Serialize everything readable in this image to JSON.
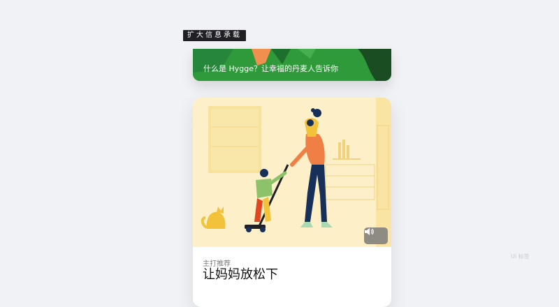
{
  "tag": {
    "label": "扩大信息承载"
  },
  "banner": {
    "title": "什么是 Hygge？让幸福的丹麦人告诉你"
  },
  "card": {
    "caption": "主打推荐",
    "headline": "让妈妈放松下"
  },
  "sound_button": {
    "icon": "speaker-icon"
  },
  "watermark": "Ui 标签",
  "colors": {
    "banner_green": "#2f9a3a",
    "illustration_bg": "#fdf0c8",
    "accent_orange": "#f07f45",
    "navy": "#17305a"
  }
}
